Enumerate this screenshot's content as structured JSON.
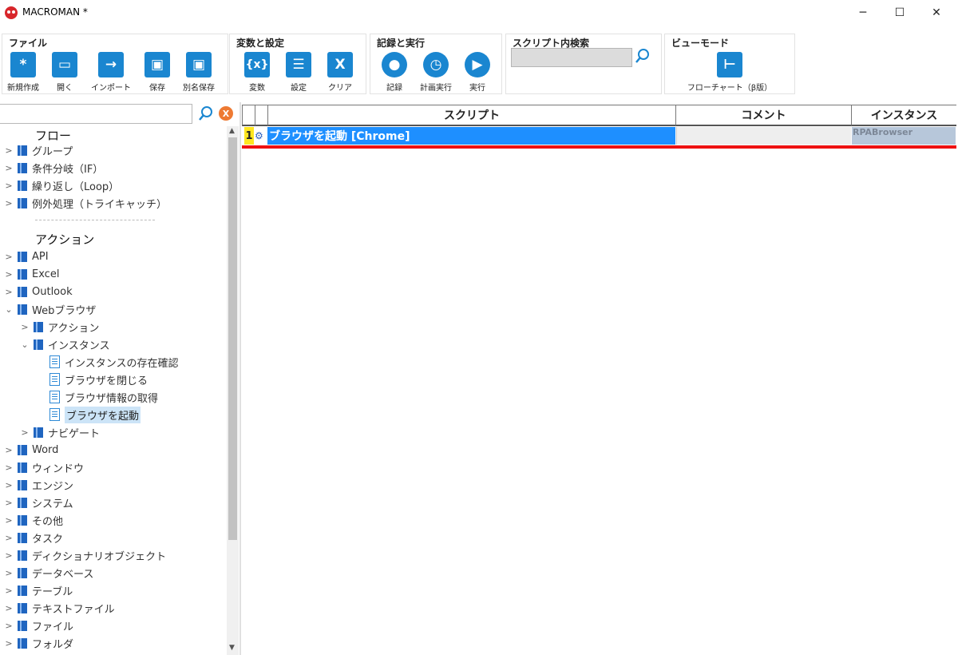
{
  "window": {
    "title": "MACROMAN *",
    "controls": {
      "minimize": "─",
      "maximize": "☐",
      "close": "✕"
    }
  },
  "ribbon": {
    "file": {
      "title": "ファイル",
      "buttons": [
        {
          "label": "新規作成",
          "glyph": "*"
        },
        {
          "label": "開く",
          "glyph": "▭"
        },
        {
          "label": "インポート",
          "glyph": "→"
        },
        {
          "label": "保存",
          "glyph": "▣"
        },
        {
          "label": "別名保存",
          "glyph": "▣"
        }
      ]
    },
    "variables": {
      "title": "変数と設定",
      "buttons": [
        {
          "label": "変数",
          "glyph": "{x}"
        },
        {
          "label": "設定",
          "glyph": "☰"
        },
        {
          "label": "クリア",
          "glyph": "X"
        }
      ]
    },
    "record": {
      "title": "記録と実行",
      "buttons": [
        {
          "label": "記録",
          "glyph": "●"
        },
        {
          "label": "計画実行",
          "glyph": "◷"
        },
        {
          "label": "実行",
          "glyph": "▶"
        }
      ]
    },
    "search": {
      "title": "スクリプト内検索",
      "value": ""
    },
    "view": {
      "title": "ビューモード",
      "buttons": [
        {
          "label": "フローチャート（β版）",
          "glyph": "⊢"
        }
      ]
    }
  },
  "left_panel": {
    "search_value": "",
    "clear_glyph": "X",
    "flow_header": "フロー",
    "flow_items": [
      "グループ",
      "条件分岐（IF）",
      "繰り返し（Loop）",
      "例外処理（トライキャッチ）"
    ],
    "action_header": "アクション",
    "action_items": [
      "API",
      "Excel",
      "Outlook",
      "Webブラウザ",
      "アクション",
      "インスタンス",
      "インスタンスの存在確認",
      "ブラウザを閉じる",
      "ブラウザ情報の取得",
      "ブラウザを起動",
      "ナビゲート",
      "Word",
      "ウィンドウ",
      "エンジン",
      "システム",
      "その他",
      "タスク",
      "ディクショナリオブジェクト",
      "データベース",
      "テーブル",
      "テキストファイル",
      "ファイル",
      "フォルダ"
    ]
  },
  "grid": {
    "columns": {
      "script": "スクリプト",
      "comment": "コメント",
      "instance": "インスタンス"
    },
    "rows": [
      {
        "num": "1",
        "script": "ブラウザを起動 [Chrome]",
        "comment": "",
        "instance": "RPABrowser"
      }
    ]
  },
  "colors": {
    "ribbon_icon": "#1a86d0",
    "row_selected": "#1e8fff",
    "row_number": "#ffe620",
    "error_line": "#ee1111",
    "tree_selected": "#cce4f7"
  }
}
